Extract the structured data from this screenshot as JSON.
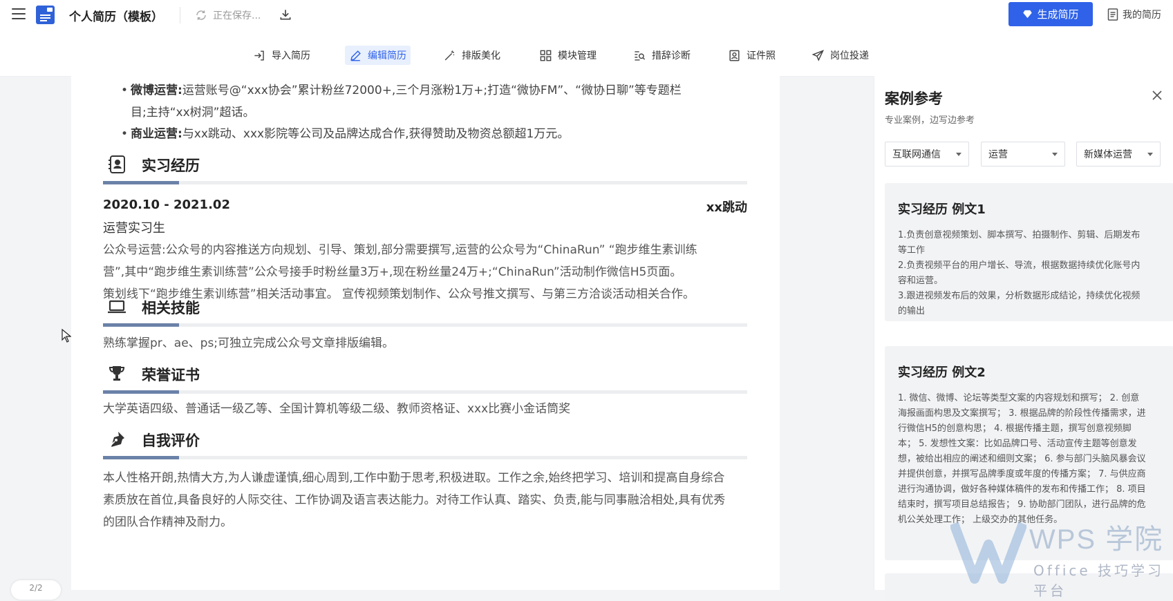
{
  "header": {
    "doc_title": "个人简历（模板）",
    "saving_status": "正在保存...",
    "generate_button": "生成简历",
    "my_resume": "我的简历"
  },
  "toolbar": {
    "items": [
      {
        "label": "导入简历"
      },
      {
        "label": "编辑简历"
      },
      {
        "label": "排版美化"
      },
      {
        "label": "模块管理"
      },
      {
        "label": "措辞诊断"
      },
      {
        "label": "证件照"
      },
      {
        "label": "岗位投递"
      }
    ]
  },
  "resume": {
    "bullets": [
      {
        "label": "微博运营:",
        "text": "运营账号@“xxx协会”累计粉丝72000+,三个月涨粉1万+;打造“微协FM”、“微协日聊”等专题栏",
        "cont": "目;主持“xx树洞”超话。"
      },
      {
        "label": "商业运营:",
        "text": "与xx跳动、xxx影院等公司及品牌达成合作,获得赞助及物资总额超1万元。"
      }
    ],
    "internship": {
      "title": "实习经历",
      "date": "2020.10  -  2021.02",
      "company": "xx跳动",
      "role": "运营实习生",
      "lines": [
        "公众号运营:公众号的内容推送方向规划、引导、策划,部分需要撰写,运营的公众号为“ChinaRun” “跑步维生素训练",
        "营”,其中“跑步维生素训练营”公众号接手时粉丝量3万+,现在粉丝量24万+;“ChinaRun”活动制作微信H5页面。",
        "策划线下“跑步维生素训练营”相关活动事宜。 宣传视频策划制作、公众号推文撰写、与第三方洽谈活动相关合作。"
      ]
    },
    "skills": {
      "title": "相关技能",
      "text": "熟练掌握pr、ae、ps;可独立完成公众号文章排版编辑。"
    },
    "honors": {
      "title": "荣誉证书",
      "text": "大学英语四级、普通话一级乙等、全国计算机等级二级、教师资格证、xxx比赛小金话筒奖"
    },
    "self_eval": {
      "title": "自我评价",
      "lines": [
        "本人性格开朗,热情大方,为人谦虚谨慎,细心周到,工作中勤于思考,积极进取。工作之余,始终把学习、培训和提高自身综合",
        "素质放在首位,具备良好的人际交往、工作协调及语言表达能力。对待工作认真、踏实、负责,能与同事融洽相处,具有优秀",
        "的团队合作精神及耐力。"
      ]
    },
    "pager": "2/2"
  },
  "panel": {
    "title": "案例参考",
    "subtitle": "专业案例，边写边参考",
    "selects": [
      "互联网通信",
      "运营",
      "新媒体运营"
    ],
    "cards": [
      {
        "title": "实习经历 例文1",
        "lines": [
          "1.负责创意视频策划、脚本撰写、拍摄制作、剪辑、后期发布等工作",
          "2.负责视频平台的用户增长、导流，根据数据持续优化账号内容和运营。",
          "3.跟进视频发布后的效果，分析数据形成结论，持续优化视频的输出"
        ]
      },
      {
        "title": "实习经历 例文2",
        "lines": [
          "1. 微信、微博、论坛等类型文案的内容规划和撰写； 2. 创意海报画面构思及文案撰写； 3. 根据品牌的阶段性传播需求，进行微信H5的创意构思； 4. 根据传播主题，撰写创意视频脚本； 5. 发想性文案：比如品牌口号、活动宣传主题等创意发想，被给出相应的阐述和细则文案； 6. 参与部门头脑风暴会议并提供创意，并撰写品牌季度或年度的传播方案； 7. 与供应商进行沟通协调，做好各种媒体稿件的发布和传播工作； 8. 项目结束时，撰写项目总结报告； 9. 协助部门团队，进行品牌的危机公关处理工作； 上级交办的其他任务。"
        ]
      }
    ]
  },
  "watermark": {
    "brand": "WPS 学院",
    "tagline": "Office 技巧学习平台"
  },
  "colors": {
    "accent": "#2f62e8",
    "section_bar": "#6b82a8"
  }
}
